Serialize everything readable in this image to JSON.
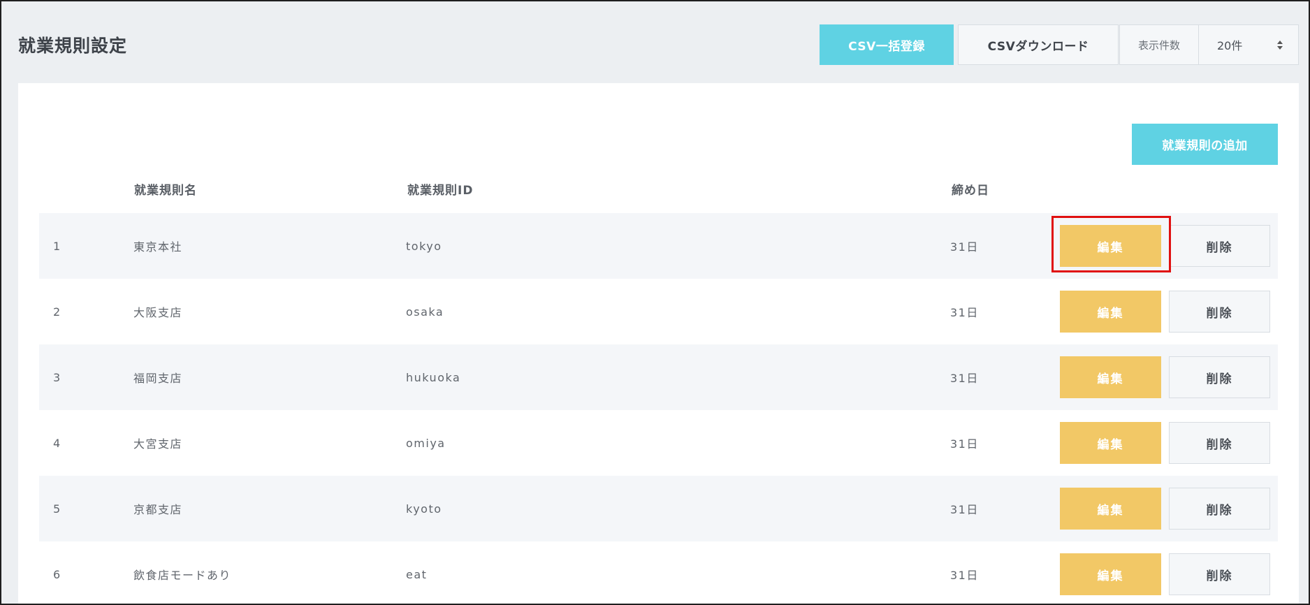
{
  "header": {
    "title": "就業規則設定",
    "csv_upload_label": "CSV一括登録",
    "csv_download_label": "CSVダウンロード",
    "per_page_label": "表示件数",
    "per_page_value": "20件"
  },
  "panel": {
    "add_button_label": "就業規則の追加"
  },
  "table": {
    "columns": [
      "",
      "就業規則名",
      "就業規則ID",
      "締め日"
    ],
    "edit_label": "編集",
    "delete_label": "削除",
    "rows": [
      {
        "num": "1",
        "name": "東京本社",
        "id": "tokyo",
        "closing": "31日"
      },
      {
        "num": "2",
        "name": "大阪支店",
        "id": "osaka",
        "closing": "31日"
      },
      {
        "num": "3",
        "name": "福岡支店",
        "id": "hukuoka",
        "closing": "31日"
      },
      {
        "num": "4",
        "name": "大宮支店",
        "id": "omiya",
        "closing": "31日"
      },
      {
        "num": "5",
        "name": "京都支店",
        "id": "kyoto",
        "closing": "31日"
      },
      {
        "num": "6",
        "name": "飲食店モードあり",
        "id": "eat",
        "closing": "31日"
      }
    ]
  },
  "colors": {
    "accent_cyan": "#5fd2e3",
    "edit_yellow": "#f2c866",
    "highlight_red": "#e01010"
  }
}
